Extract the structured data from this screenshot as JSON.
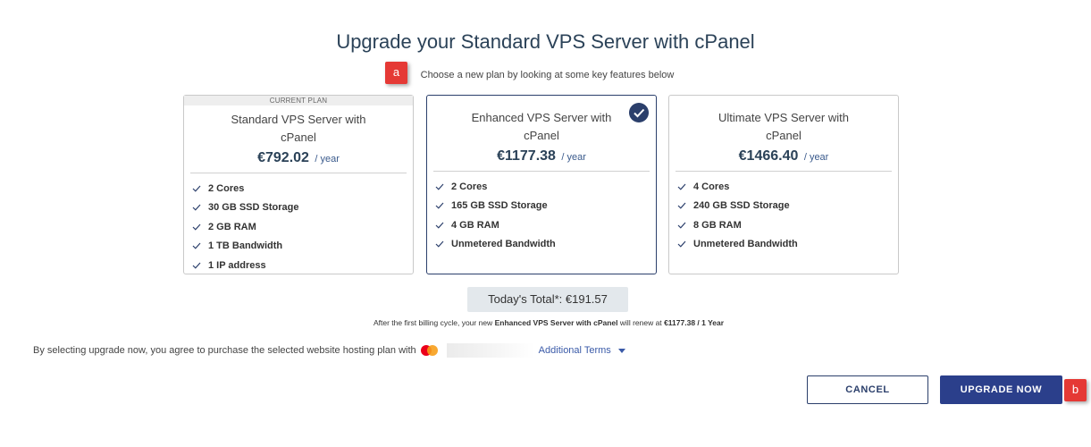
{
  "header": {
    "title": "Upgrade your Standard VPS Server with cPanel",
    "subtitle": "Choose a new plan by looking at some key features below"
  },
  "markers": {
    "a": "a",
    "b": "b"
  },
  "plans": [
    {
      "tag": "CURRENT PLAN",
      "name": "Standard VPS Server with cPanel",
      "price": "€792.02",
      "period": "/ year",
      "selected": false,
      "features": [
        "2 Cores",
        "30 GB SSD Storage",
        "2 GB RAM",
        "1 TB Bandwidth",
        "1 IP address"
      ]
    },
    {
      "name": "Enhanced VPS Server with cPanel",
      "price": "€1177.38",
      "period": "/ year",
      "selected": true,
      "features": [
        "2 Cores",
        "165 GB SSD Storage",
        "4 GB RAM",
        "Unmetered Bandwidth"
      ]
    },
    {
      "name": "Ultimate VPS Server with cPanel",
      "price": "€1466.40",
      "period": "/ year",
      "selected": false,
      "features": [
        "4 Cores",
        "240 GB SSD Storage",
        "8 GB RAM",
        "Unmetered Bandwidth"
      ]
    }
  ],
  "total": {
    "label": "Today's Total*: €191.57"
  },
  "renewal": {
    "prefix": "After the first billing cycle, your new",
    "plan": "Enhanced VPS Server with cPanel",
    "middle": "will renew at",
    "price": "€1177.38 / 1 Year"
  },
  "terms": {
    "text": "By selecting upgrade now, you agree to purchase the selected website hosting plan with",
    "payment_icon": "mastercard-icon",
    "link": "Additional Terms"
  },
  "buttons": {
    "cancel": "CANCEL",
    "upgrade": "UPGRADE NOW"
  },
  "colors": {
    "primary": "#2b3f8b",
    "heading": "#2b4258",
    "marker": "#e53935"
  }
}
